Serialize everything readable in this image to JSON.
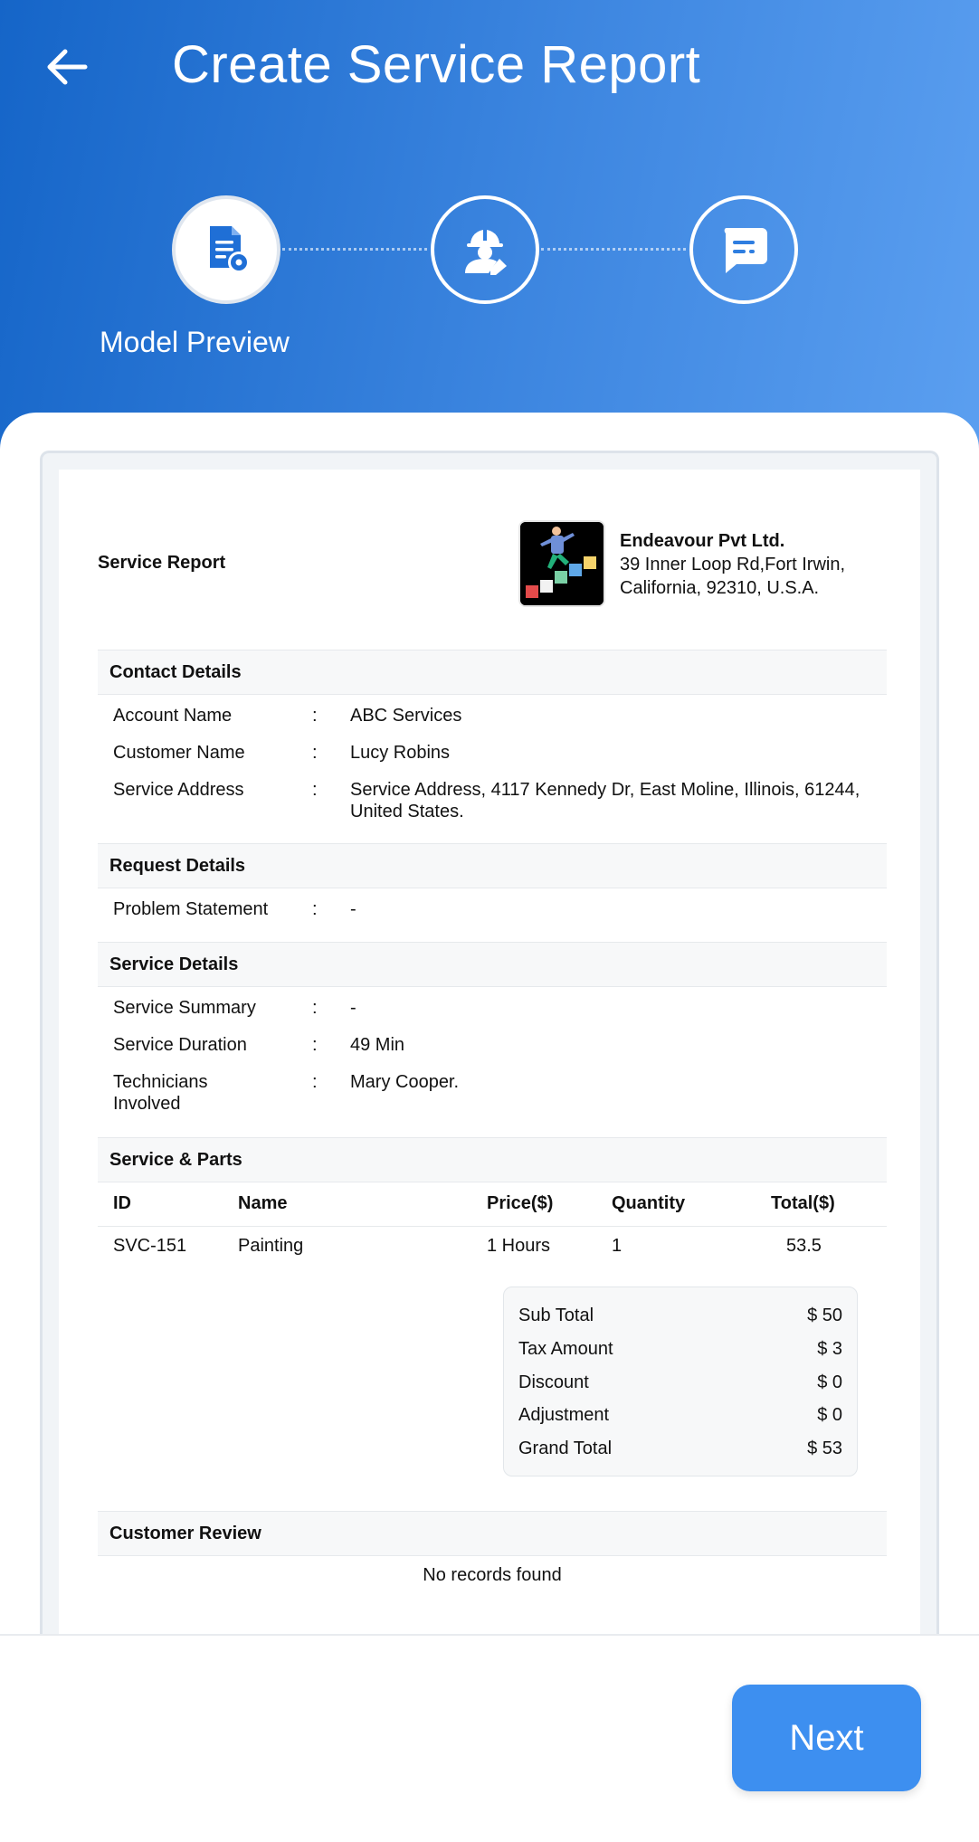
{
  "header": {
    "title": "Create Service Report",
    "steps": [
      {
        "icon": "document-settings-icon",
        "active": true
      },
      {
        "icon": "technician-icon",
        "active": false
      },
      {
        "icon": "chat-message-icon",
        "active": false
      }
    ],
    "active_step_label": "Model Preview"
  },
  "report": {
    "title": "Service Report",
    "company": {
      "name": "Endeavour Pvt Ltd.",
      "address": "39 Inner Loop Rd,Fort Irwin, California, 92310, U.S.A."
    },
    "contact_details": {
      "heading": "Contact Details",
      "rows": [
        {
          "label": "Account Name",
          "value": "ABC Services"
        },
        {
          "label": "Customer Name",
          "value": "Lucy Robins"
        },
        {
          "label": "Service Address",
          "value": "Service Address, 4117 Kennedy Dr, East Moline, Illinois, 61244, United States."
        }
      ]
    },
    "request_details": {
      "heading": "Request Details",
      "rows": [
        {
          "label": "Problem Statement",
          "value": "-"
        }
      ]
    },
    "service_details": {
      "heading": "Service Details",
      "rows": [
        {
          "label": "Service Summary",
          "value": "-"
        },
        {
          "label": "Service Duration",
          "value": "49 Min"
        },
        {
          "label": "Technicians Involved",
          "value": "Mary Cooper."
        }
      ]
    },
    "colon": ":",
    "service_parts": {
      "heading": "Service & Parts",
      "columns": [
        "ID",
        "Name",
        "Price($)",
        "Quantity",
        "Total($)"
      ],
      "rows": [
        {
          "id": "SVC-151",
          "name": "Painting",
          "price": "1 Hours",
          "quantity": "1",
          "total": "53.5"
        }
      ]
    },
    "totals": [
      {
        "label": "Sub Total",
        "amount": "$ 50"
      },
      {
        "label": "Tax Amount",
        "amount": "$ 3"
      },
      {
        "label": "Discount",
        "amount": "$ 0"
      },
      {
        "label": "Adjustment",
        "amount": "$ 0"
      },
      {
        "label": "Grand Total",
        "amount": "$ 53"
      }
    ],
    "customer_review": {
      "heading": "Customer Review",
      "empty_text": "No records found"
    }
  },
  "footer": {
    "next_label": "Next"
  },
  "colors": {
    "header_start": "#1565c8",
    "header_end": "#5b9ff0",
    "next_button": "#3d8ff0",
    "step_icon_blue": "#1f6fd6"
  }
}
